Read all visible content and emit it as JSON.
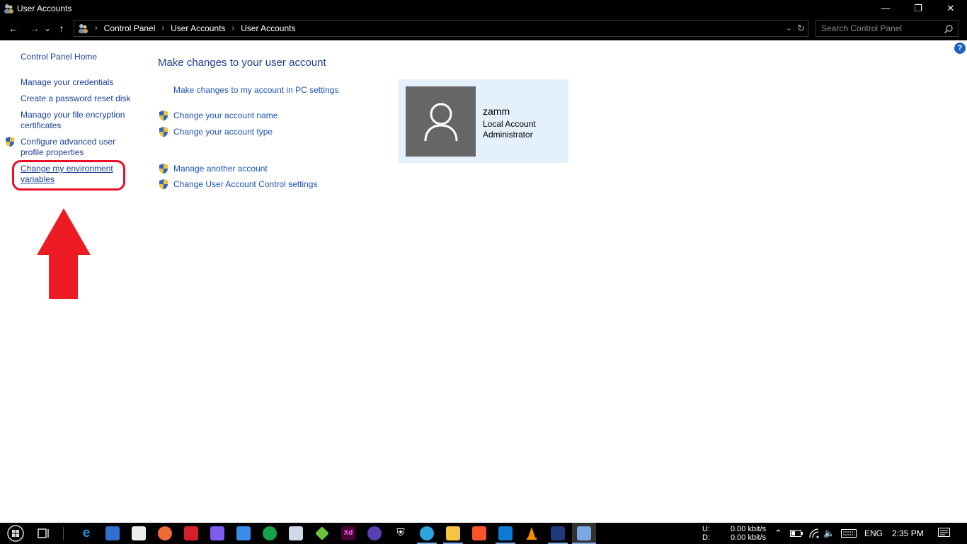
{
  "window": {
    "title": "User Accounts",
    "minimize_glyph": "—",
    "maximize_glyph": "❐",
    "close_glyph": "✕"
  },
  "nav": {
    "back_glyph": "←",
    "forward_glyph": "→",
    "recent_glyph": "⌄",
    "up_glyph": "↑",
    "breadcrumbs": [
      "Control Panel",
      "User Accounts",
      "User Accounts"
    ],
    "separator": "›",
    "search_placeholder": "Search Control Panel"
  },
  "help_label": "?",
  "sidebar": {
    "home": "Control Panel Home",
    "items": [
      {
        "label": "Manage your credentials"
      },
      {
        "label": "Create a password reset disk"
      },
      {
        "label": "Manage your file encryption certificates",
        "line1": "Manage your file encryption",
        "line2": "certificates"
      },
      {
        "label": "Configure advanced user profile properties",
        "line1": "Configure advanced user",
        "line2": "profile properties"
      },
      {
        "label": "Change my environment variables",
        "line1": "Change my environment",
        "line2": "variables"
      }
    ]
  },
  "main": {
    "heading": "Make changes to your user account",
    "pc_settings_link": "Make changes to my account in PC settings",
    "actions": [
      "Change your account name",
      "Change your account type",
      "Manage another account",
      "Change User Account Control settings"
    ]
  },
  "account": {
    "name": "zamm",
    "type": "Local Account",
    "role": "Administrator"
  },
  "taskbar": {
    "net_up_label": "U:",
    "net_down_label": "D:",
    "net_up": "0.00 kbit/s",
    "net_down": "0.00 kbit/s",
    "language": "ENG",
    "time": "2:35 PM"
  },
  "colors": {
    "link": "#1a3e93",
    "annotation": "#e8102a",
    "card_bg": "#e4f0fb"
  }
}
